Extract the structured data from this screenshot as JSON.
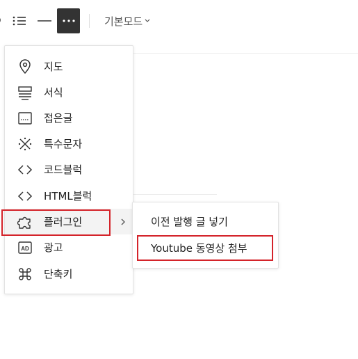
{
  "toolbar": {
    "mode_label": "기본모드",
    "icons": [
      "partial-icon",
      "list-icon",
      "horizontal-rule-icon",
      "more-icon",
      "chevron-down-icon"
    ]
  },
  "menu": {
    "items": [
      {
        "label": "지도",
        "icon": "map-pin-icon"
      },
      {
        "label": "서식",
        "icon": "format-icon"
      },
      {
        "label": "접은글",
        "icon": "fold-icon"
      },
      {
        "label": "특수문자",
        "icon": "special-char-icon"
      },
      {
        "label": "코드블럭",
        "icon": "code-icon"
      },
      {
        "label": "HTML블럭",
        "icon": "html-code-icon"
      },
      {
        "label": "플러그인",
        "icon": "puzzle-icon"
      },
      {
        "label": "광고",
        "icon": "ad-icon"
      },
      {
        "label": "단축키",
        "icon": "command-icon"
      }
    ]
  },
  "submenu": {
    "items": [
      {
        "label": "이전 발행 글 넣기"
      },
      {
        "label": "Youtube 동영상 첨부"
      }
    ]
  },
  "colors": {
    "highlight": "#d4232a",
    "active_bg": "#f3f3f3",
    "more_button_bg": "#333333"
  }
}
